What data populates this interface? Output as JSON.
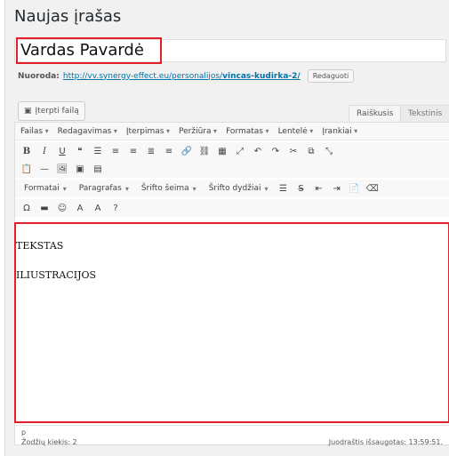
{
  "page": {
    "title": "Naujas įrašas"
  },
  "title_input": {
    "value": "Vardas Pavardė"
  },
  "permalink": {
    "label": "Nuoroda:",
    "url_prefix": "http://vv.synergy-effect.eu/personalijos/",
    "slug": "vincas-kudirka-2/",
    "edit_label": "Redaguoti"
  },
  "media": {
    "insert_label": "Įterpti failą"
  },
  "editor_tabs": {
    "visual": "Raiškusis",
    "text": "Tekstinis"
  },
  "menubar": [
    "Failas",
    "Redagavimas",
    "Įterpimas",
    "Peržiūra",
    "Formatas",
    "Lentelė",
    "Įrankiai"
  ],
  "format_bar": {
    "formats": "Formatai",
    "block": "Paragrafas",
    "font_family": "Šrifto šeima",
    "font_size": "Šrifto dydžiai"
  },
  "content": {
    "line1": "TEKSTAS",
    "line2": "ILIUSTRACIJOS"
  },
  "status": {
    "path": "p",
    "word_count": "Žodžių kiekis: 2",
    "saved": "Juodraštis išsaugotas: 13:59:51."
  },
  "colors": {
    "highlight": "#e3202a",
    "link": "#0073aa"
  }
}
